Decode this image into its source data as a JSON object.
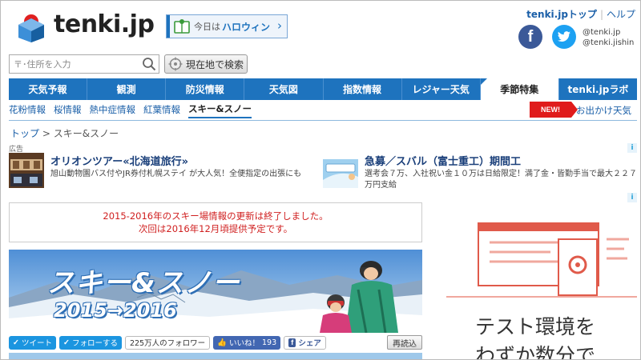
{
  "header": {
    "logo_text": "tenki.jp",
    "today": {
      "prefix": "今日は",
      "value": "ハロウィン"
    },
    "top_links": {
      "top": "tenki.jpトップ",
      "help": "ヘルプ"
    },
    "sns_accounts": [
      "@tenki.jp",
      "@tenki.jishin"
    ]
  },
  "search": {
    "placeholder": "〒･住所を入力",
    "locate_label": "現在地で検索"
  },
  "nav": {
    "items": [
      "天気予報",
      "観測",
      "防災情報",
      "天気図",
      "指数情報",
      "レジャー天気",
      "季節特集",
      "tenki.jpラボ"
    ],
    "active": "季節特集"
  },
  "subnav": {
    "items": [
      "花粉情報",
      "桜情報",
      "熱中症情報",
      "紅葉情報",
      "スキー&スノー"
    ],
    "active": "スキー&スノー",
    "new_badge": "NEW!",
    "outing_link": "お出かけ天気"
  },
  "breadcrumb": {
    "home": "トップ",
    "separator": ">",
    "current": "スキー&スノー"
  },
  "ads": {
    "label": "広告",
    "items": [
      {
        "title": "オリオンツアー«北海道旅行»",
        "desc": "旭山動物園バス付やJR券付札幌ステイ が大人気！全便指定の出張にも"
      },
      {
        "title": "急募／スバル（富士重工）期間工",
        "desc": "選考会７万、入社祝い金１０万は日給限定！満了金・皆勤手当で最大２２７万円支給"
      }
    ]
  },
  "notice": {
    "line1": "2015-2016年のスキー場情報の更新は終了しました。",
    "line2": "次回は2016年12月頃提供予定です。"
  },
  "banner": {
    "title": "スキー&スノー",
    "years": "2015→2016"
  },
  "share": {
    "tweet": "ツイート",
    "follow": "フォローする",
    "followers": "225万人のフォロワー",
    "like": "いいね！",
    "like_count": "193",
    "share": "シェア",
    "reload": "再読込"
  },
  "side_ad": {
    "lines": [
      "テスト環境を",
      "わずか数分で"
    ]
  },
  "colors": {
    "brand_blue": "#1e73be",
    "notice_red": "#d02020",
    "new_red": "#e01b1b"
  }
}
